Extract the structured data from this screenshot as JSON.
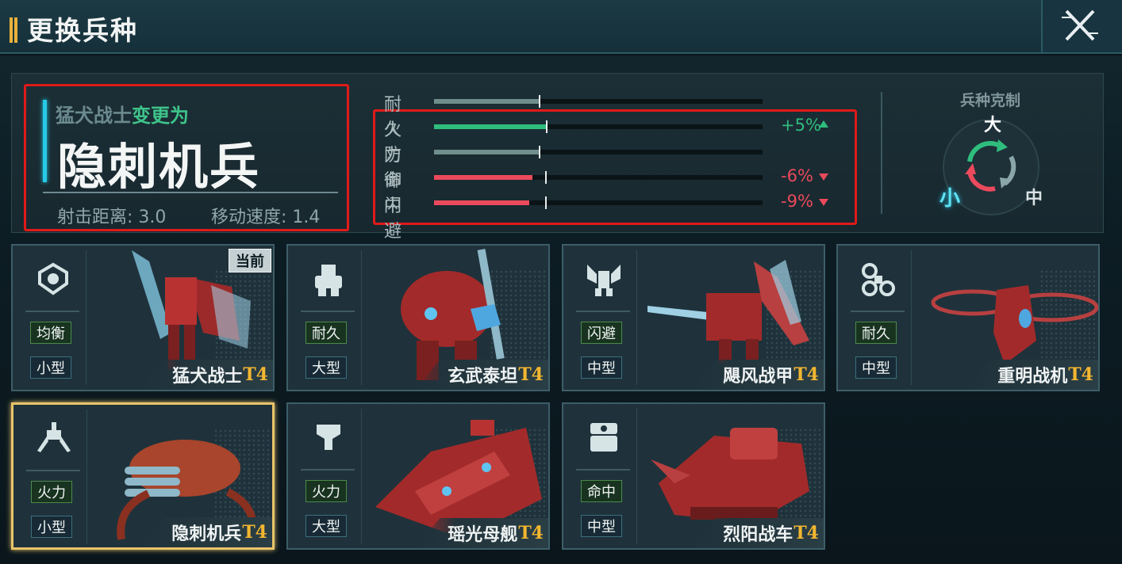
{
  "header": {
    "title": "更换兵种"
  },
  "change": {
    "from_name": "猛犬战士",
    "to_word": "变更为",
    "target_name": "隐刺机兵",
    "range_label": "射击距离: 3.0",
    "speed_label": "移动速度: 1.4"
  },
  "stats": [
    {
      "label": "耐久",
      "base": 0.32,
      "new": 0.32,
      "delta": ""
    },
    {
      "label": "火力",
      "base": 0.32,
      "new": 0.34,
      "delta": "+5%",
      "direction": "up"
    },
    {
      "label": "防御",
      "base": 0.32,
      "new": 0.32,
      "delta": ""
    },
    {
      "label": "命中",
      "base": 0.32,
      "new": 0.3,
      "delta": "-6%",
      "direction": "down"
    },
    {
      "label": "闪避",
      "base": 0.32,
      "new": 0.29,
      "delta": "-9%",
      "direction": "down"
    }
  ],
  "colors": {
    "neutral": "#6f8e8c",
    "up": "#2fbd7e",
    "down": "#ea4a5c",
    "selected": "#e8c46a",
    "tier": "#f2b630"
  },
  "counter": {
    "title": "兵种克制",
    "large": "大",
    "medium": "中",
    "small": "小"
  },
  "units": [
    {
      "name": "猛犬战士",
      "tier": "T4",
      "role": "均衡",
      "size": "小型",
      "icon": "balance-icon",
      "current": true,
      "current_label": "当前"
    },
    {
      "name": "玄武泰坦",
      "tier": "T4",
      "role": "耐久",
      "size": "大型",
      "icon": "heavy-mech-icon"
    },
    {
      "name": "飓风战甲",
      "tier": "T4",
      "role": "闪避",
      "size": "中型",
      "icon": "winged-mech-icon"
    },
    {
      "name": "重明战机",
      "tier": "T4",
      "role": "耐久",
      "size": "中型",
      "icon": "drone-icon"
    },
    {
      "name": "隐刺机兵",
      "tier": "T4",
      "role": "火力",
      "size": "小型",
      "icon": "spider-icon",
      "selected": true
    },
    {
      "name": "瑶光母舰",
      "tier": "T4",
      "role": "火力",
      "size": "大型",
      "icon": "armor-icon"
    },
    {
      "name": "烈阳战车",
      "tier": "T4",
      "role": "命中",
      "size": "中型",
      "icon": "tank-icon"
    }
  ]
}
